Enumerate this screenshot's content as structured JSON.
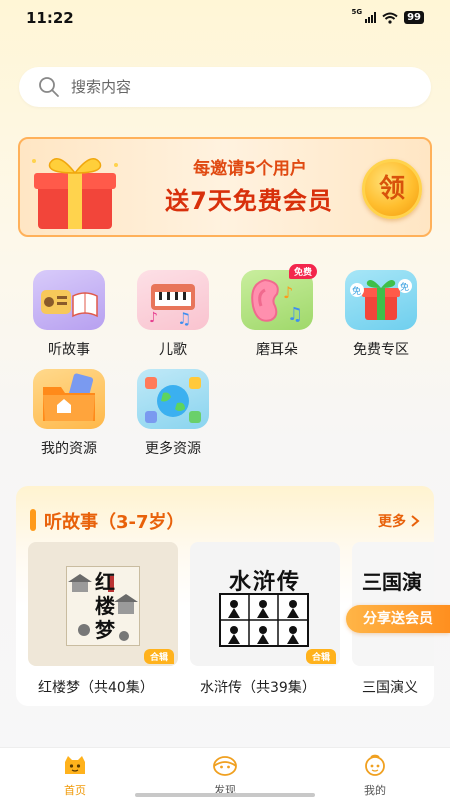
{
  "status": {
    "time": "11:22",
    "network": "5G",
    "battery": "99"
  },
  "search": {
    "placeholder": "搜索内容"
  },
  "banner": {
    "line1": "每邀请5个用户",
    "line2": "送7天免费会员",
    "button": "领"
  },
  "categories": [
    {
      "label": "听故事",
      "icon": "radio-book-icon",
      "color": "#c8b6f4"
    },
    {
      "label": "儿歌",
      "icon": "piano-icon",
      "color": "#fcd3dc"
    },
    {
      "label": "磨耳朵",
      "icon": "ear-music-icon",
      "color": "#b9e58a",
      "tag": "免费"
    },
    {
      "label": "免费专区",
      "icon": "gift-box-icon",
      "color": "#8fdcf2"
    },
    {
      "label": "我的资源",
      "icon": "folder-home-icon",
      "color": "#ffca6e"
    },
    {
      "label": "更多资源",
      "icon": "globe-apps-icon",
      "color": "#9ddbf0"
    }
  ],
  "story_section": {
    "title": "听故事（3-7岁）",
    "more": "更多",
    "books": [
      {
        "name": "红楼梦（共40集）",
        "cover_title": "红楼梦",
        "badge": "合辑"
      },
      {
        "name": "水浒传（共39集）",
        "cover_title": "水浒传",
        "badge": "合辑"
      },
      {
        "name": "三国演义",
        "cover_title": "三国演"
      }
    ]
  },
  "share_button": "分享送会员",
  "tabs": [
    {
      "label": "首页",
      "active": true
    },
    {
      "label": "发现",
      "active": false
    },
    {
      "label": "我的",
      "active": false
    }
  ],
  "colors": {
    "accent": "#f09a0a",
    "title": "#e8610a",
    "banner_text": "#d8300b"
  }
}
